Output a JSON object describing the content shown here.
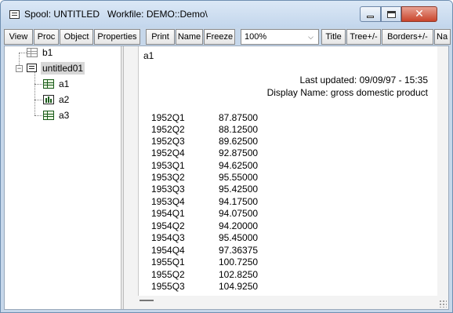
{
  "window": {
    "title": "Spool: UNTITLED   Workfile: DEMO::Demo\\",
    "controls": {
      "minimize_icon": "minimize-icon",
      "maximize_icon": "maximize-icon",
      "close_icon": "close-icon",
      "close_glyph": "✕"
    }
  },
  "toolbar": {
    "buttons": [
      "View",
      "Proc",
      "Object",
      "Properties",
      "Print",
      "Name",
      "Freeze",
      "Title",
      "Tree+/-",
      "Borders+/-",
      "Na"
    ],
    "zoom": {
      "value": "100%",
      "arrow": "⌵"
    }
  },
  "tree": {
    "nodes": [
      {
        "label": "b1",
        "icon": "table-icon"
      },
      {
        "label": "untitled01",
        "icon": "spool-icon",
        "expander": "−"
      },
      {
        "label": "a1",
        "icon": "table-icon"
      },
      {
        "label": "a2",
        "icon": "graph-icon"
      },
      {
        "label": "a3",
        "icon": "table-icon"
      }
    ]
  },
  "content": {
    "object_name": "a1",
    "last_updated": "Last updated: 09/09/97 - 15:35",
    "display_name": "Display Name: gross domestic product",
    "rows": [
      [
        "1952Q1",
        "87.87500"
      ],
      [
        "1952Q2",
        "88.12500"
      ],
      [
        "1952Q3",
        "89.62500"
      ],
      [
        "1952Q4",
        "92.87500"
      ],
      [
        "1953Q1",
        "94.62500"
      ],
      [
        "1953Q2",
        "95.55000"
      ],
      [
        "1953Q3",
        "95.42500"
      ],
      [
        "1953Q4",
        "94.17500"
      ],
      [
        "1954Q1",
        "94.07500"
      ],
      [
        "1954Q2",
        "94.20000"
      ],
      [
        "1954Q3",
        "95.45000"
      ],
      [
        "1954Q4",
        "97.36375"
      ],
      [
        "1955Q1",
        "100.7250"
      ],
      [
        "1955Q2",
        "102.8250"
      ],
      [
        "1955Q3",
        "104.9250"
      ]
    ]
  },
  "colors": {
    "frame": "#c6d7ea",
    "close_button": "#c9442b",
    "tree_icon_green": "#1a5c1a",
    "selection": "#d7d7d7"
  }
}
